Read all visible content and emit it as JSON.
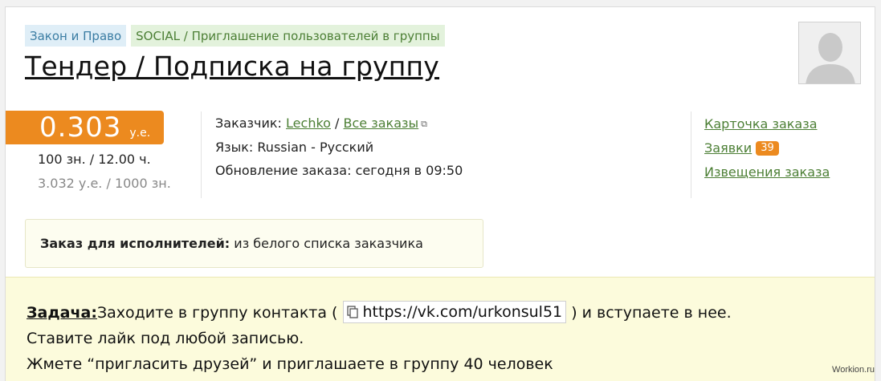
{
  "tags": {
    "category": "Закон и Право",
    "subcategory": "SOCIAL / Приглашение пользователей в группы"
  },
  "order": {
    "title": "Тендер / Подписка на группу",
    "price": "0.303",
    "price_unit": "у.е.",
    "rate": "100 зн. / 12.00 ч.",
    "rate_alt": "3.032 у.е. / 1000 зн."
  },
  "info": {
    "customer_label": "Заказчик:",
    "customer_name": "Lechko",
    "separator": "/",
    "all_orders_label": "Все заказы",
    "language_label": "Язык:",
    "language_value": "Russian - Русский",
    "update_label": "Обновление заказа:",
    "update_value": "сегодня в 09:50"
  },
  "side_links": {
    "card": "Карточка заказа",
    "bids": "Заявки",
    "bids_count": "39",
    "notices": "Извещения заказа"
  },
  "whitelist": {
    "label": "Заказ для исполнителей:",
    "value": "из белого списка заказчика"
  },
  "task": {
    "label": "Задача:",
    "line1_before": "Заходите в группу контакта (",
    "link": "https://vk.com/urkonsul51",
    "line1_after": ") и вступаете в нее.",
    "line2": "Ставите лайк под любой записью.",
    "line3": "Жмете “пригласить друзей” и приглашаете в группу 40 человек"
  },
  "watermark": "Workion.ru",
  "colors": {
    "accent_orange": "#ec8a1f",
    "link_green": "#4c7f35",
    "task_background": "#fcfbdc"
  },
  "icons": [
    "avatar-placeholder-icon",
    "external-link-icon",
    "document-icon"
  ]
}
